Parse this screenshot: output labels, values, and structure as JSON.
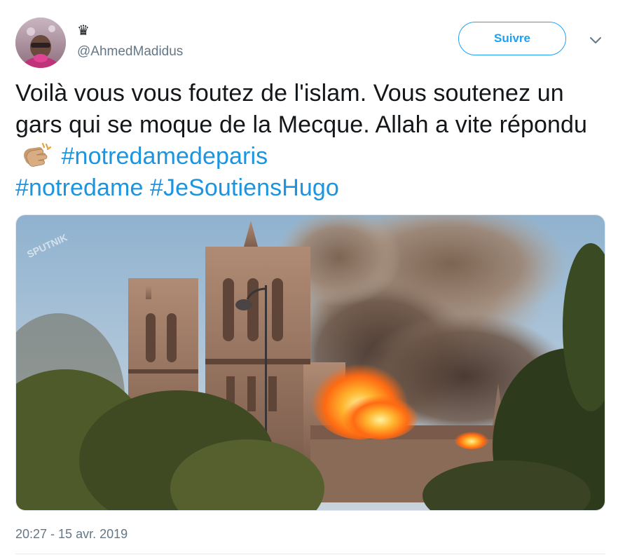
{
  "user": {
    "display_name": "♛",
    "handle": "@AhmedMadidus"
  },
  "follow_button": {
    "label": "Suivre"
  },
  "caret_icon": "chevron-down-icon",
  "tweet": {
    "text_parts": [
      "Voilà vous vous foutez de l'islam. Vous soutenez un gars qui se moque de la Mecque. Allah a vite répondu ",
      " "
    ],
    "emoji": "clapping-hands-emoji",
    "hashtags": [
      "#notredamedeparis",
      "#notredame",
      "#JeSoutiensHugo"
    ]
  },
  "media": {
    "watermark": "SPUTNIK"
  },
  "timestamp": "20:27 - 15 avr. 2019",
  "colors": {
    "accent": "#1da1f2",
    "hashtag": "#1b95e0",
    "text": "#14171a",
    "muted": "#657786"
  }
}
